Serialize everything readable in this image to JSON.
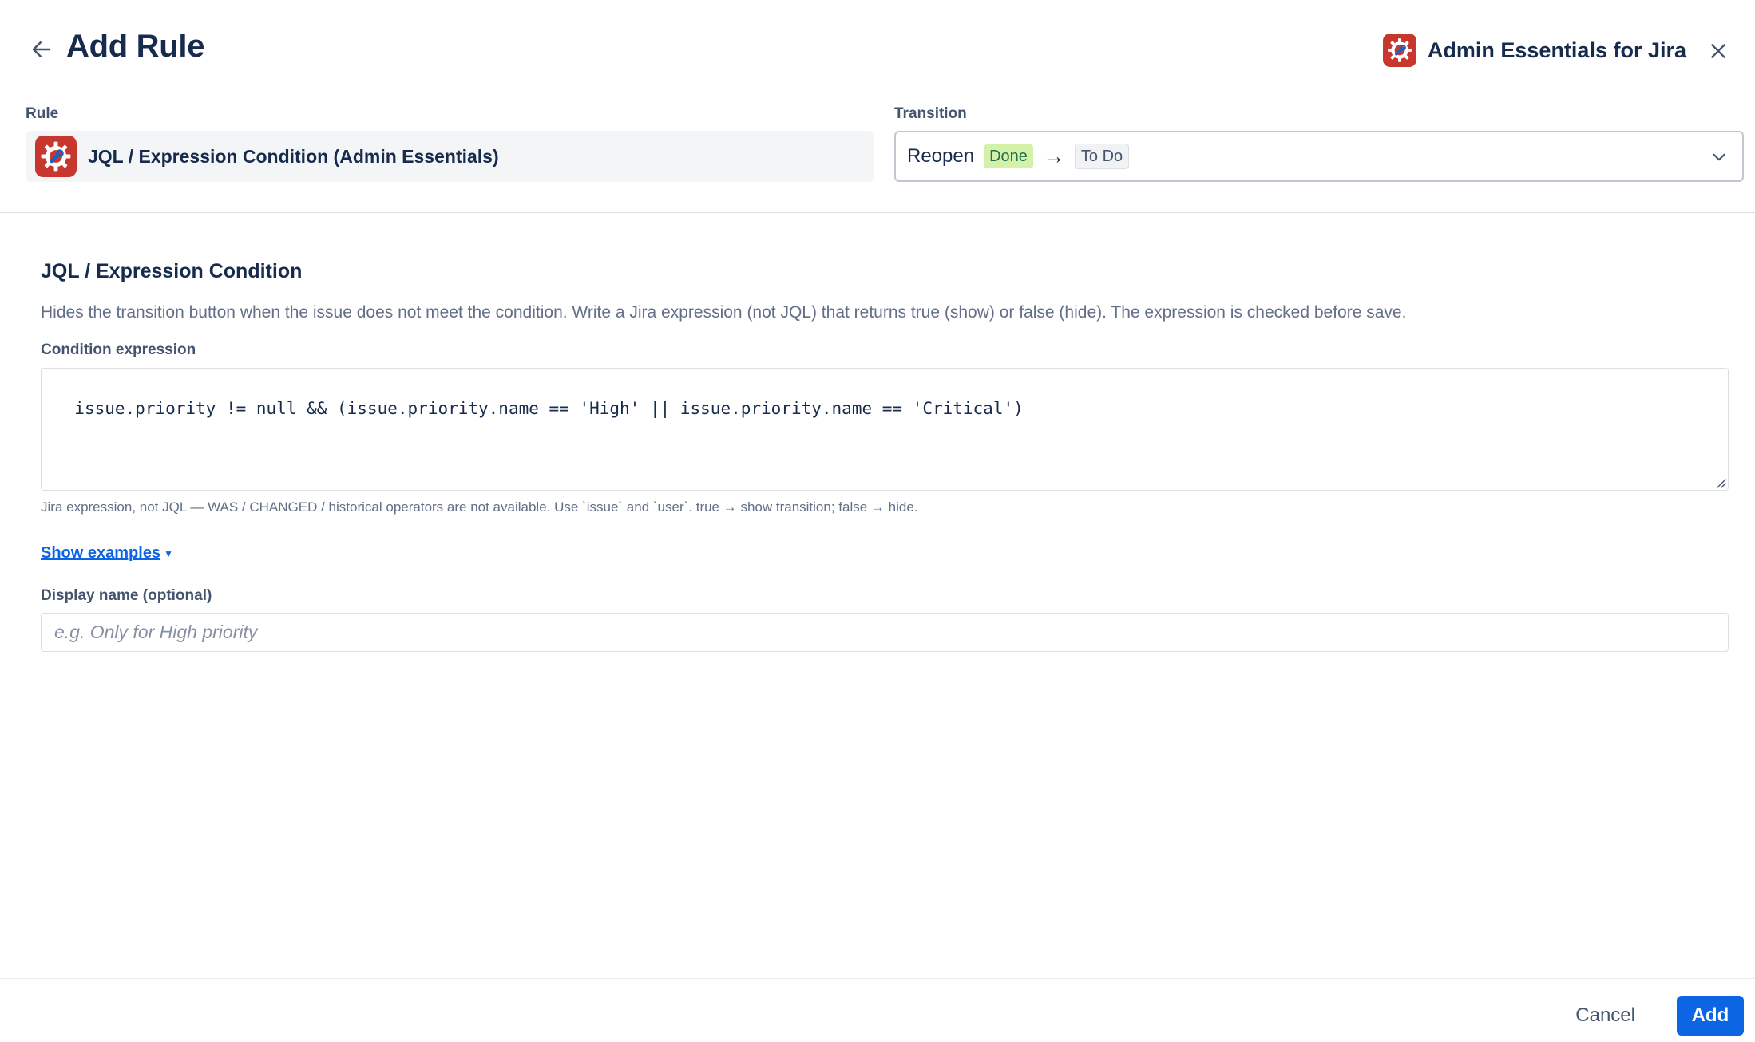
{
  "header": {
    "title": "Add Rule",
    "brand_name": "Admin Essentials for Jira"
  },
  "rule": {
    "label": "Rule",
    "value": "JQL / Expression Condition (Admin Essentials)"
  },
  "transition": {
    "label": "Transition",
    "name": "Reopen",
    "from_status": "Done",
    "arrow": "→",
    "to_status": "To Do"
  },
  "section": {
    "title": "JQL / Expression Condition",
    "description": "Hides the transition button when the issue does not meet the condition. Write a Jira expression (not JQL) that returns true (show) or false (hide). The expression is checked before save.",
    "condition_label": "Condition expression",
    "condition_value": "issue.priority != null && (issue.priority.name == 'High' || issue.priority.name == 'Critical')",
    "help_text": "Jira expression, not JQL — WAS / CHANGED / historical operators are not available. Use `issue` and `user`. true → show transition; false → hide.",
    "examples_link": "Show examples",
    "display_name_label": "Display name (optional)",
    "display_name_placeholder": "e.g. Only for High priority"
  },
  "footer": {
    "cancel_label": "Cancel",
    "add_label": "Add"
  },
  "colors": {
    "primary": "#0c66e4",
    "app_icon": "#c8372d",
    "done_lozenge": "#d3f1a7"
  },
  "icons": {
    "back": "arrow-left-icon",
    "close": "close-icon",
    "app": "gear-wrench-icon",
    "dropdown": "chevron-down-icon"
  }
}
